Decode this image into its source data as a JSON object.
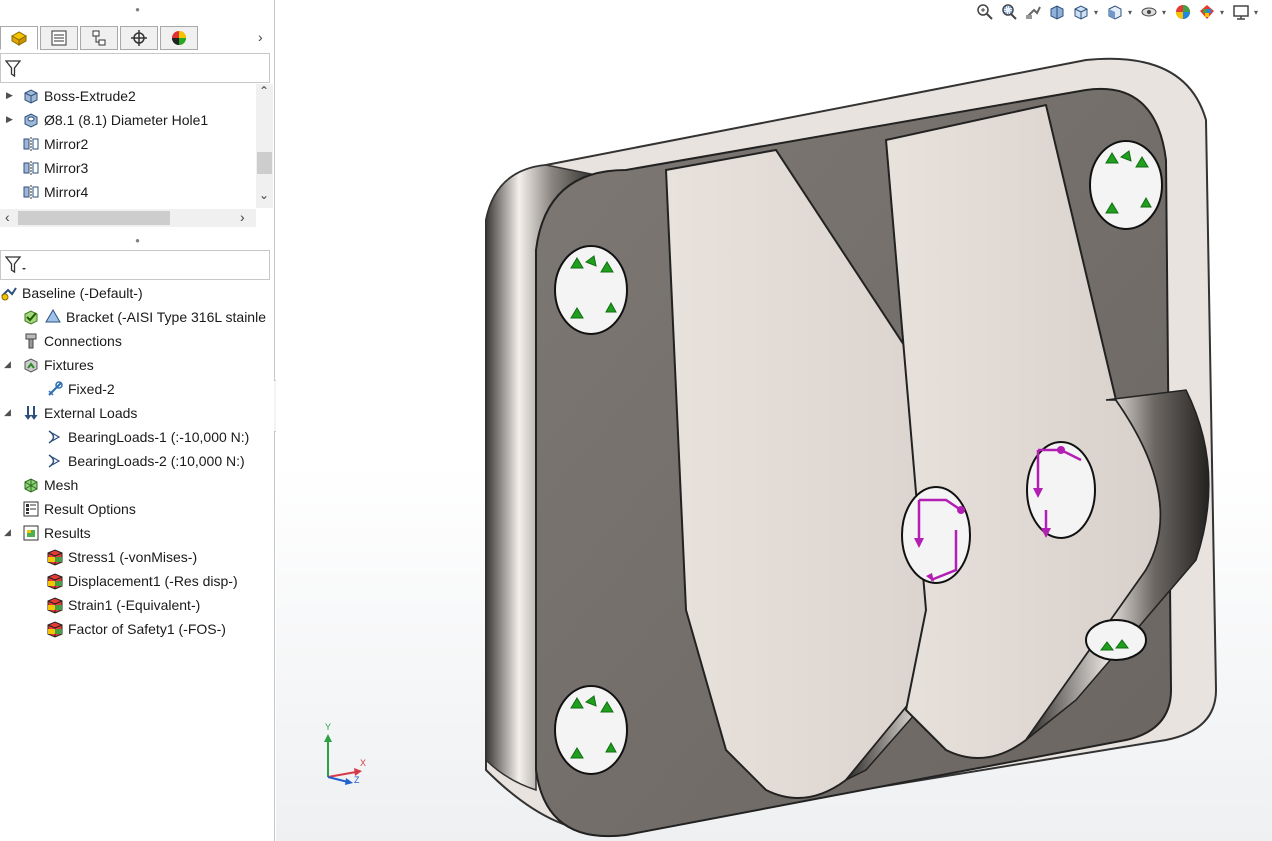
{
  "feature_tree": {
    "items": [
      {
        "label": "Boss-Extrude2",
        "icon": "extrude-icon",
        "expandable": true
      },
      {
        "label": "Ø8.1 (8.1) Diameter Hole1",
        "icon": "hole-wizard-icon",
        "expandable": true
      },
      {
        "label": "Mirror2",
        "icon": "mirror-icon",
        "expandable": false
      },
      {
        "label": "Mirror3",
        "icon": "mirror-icon",
        "expandable": false
      },
      {
        "label": "Mirror4",
        "icon": "mirror-icon",
        "expandable": false
      }
    ]
  },
  "sim_tree": {
    "root": "Baseline (-Default-)",
    "part": "Bracket (-AISI Type 316L stainle",
    "connections": "Connections",
    "fixtures": "Fixtures",
    "fixed": "Fixed-2",
    "external_loads": "External Loads",
    "load1": "BearingLoads-1 (:-10,000 N:)",
    "load2": "BearingLoads-2 (:10,000 N:)",
    "mesh": "Mesh",
    "result_options": "Result Options",
    "results": "Results",
    "stress": "Stress1 (-vonMises-)",
    "displacement": "Displacement1 (-Res disp-)",
    "strain": "Strain1 (-Equivalent-)",
    "fos": "Factor of Safety1 (-FOS-)"
  },
  "triad": {
    "x": "X",
    "y": "Y",
    "z": "Z"
  },
  "colors": {
    "fixture": "#1f9e1f",
    "load": "#b31fb3",
    "part_face": "#7a7672",
    "part_light": "#ece6e2",
    "accent": "#f5c400"
  }
}
